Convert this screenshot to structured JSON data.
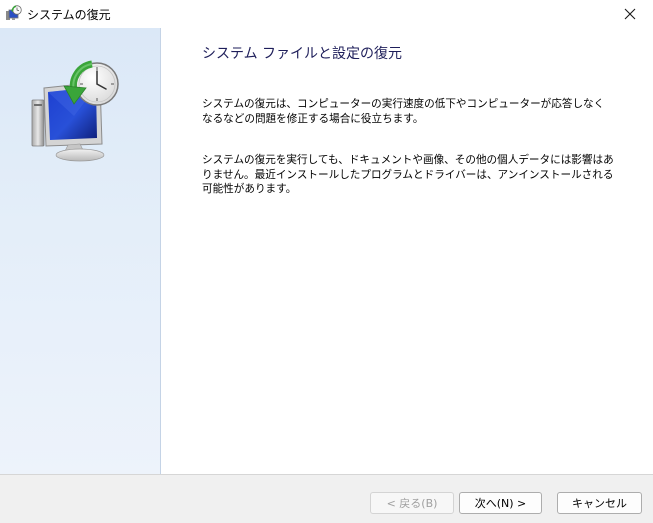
{
  "window": {
    "title": "システムの復元",
    "close_glyph": "✕",
    "icons": {
      "title": "system-restore-icon",
      "close": "close-icon",
      "hero": "system-restore-monitor-icon"
    }
  },
  "content": {
    "heading": "システム ファイルと設定の復元",
    "paragraph1": "システムの復元は、コンピューターの実行速度の低下やコンピューターが応答しなくなるなどの問題を修正する場合に役立ちます。",
    "paragraph2": "システムの復元を実行しても、ドキュメントや画像、その他の個人データには影響はありません。最近インストールしたプログラムとドライバーは、アンインストールされる可能性があります。"
  },
  "footer": {
    "back_label": "< 戻る(B)",
    "back_enabled": false,
    "next_label": "次へ(N) >",
    "cancel_label": "キャンセル"
  },
  "colors": {
    "heading": "#1e1e5a",
    "sidebar": "#dfeaf7",
    "footer": "#f0f0f0"
  }
}
